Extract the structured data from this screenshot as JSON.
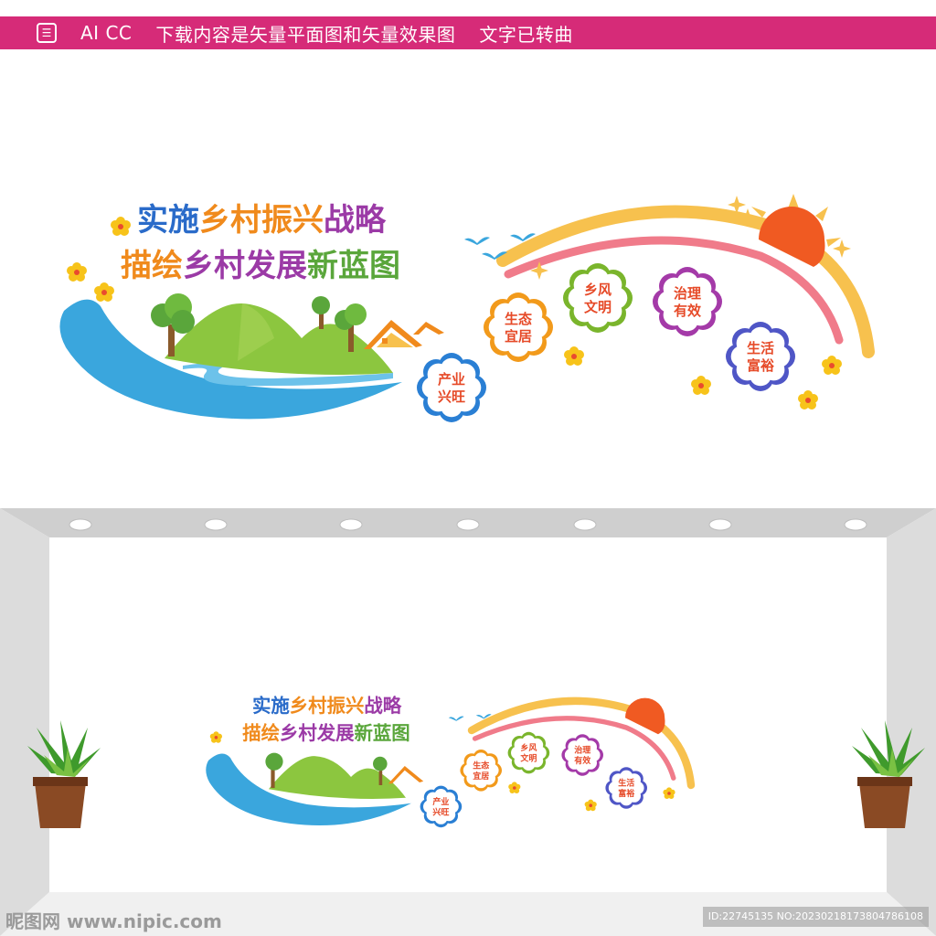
{
  "header": {
    "logo_glyph": "☰",
    "software": "AI CC",
    "description": "下载内容是矢量平面图和矢量效果图",
    "note": "文字已转曲",
    "bar_color": "#d62b78"
  },
  "design": {
    "title_line1_a": "实施",
    "title_line1_b": "乡村振兴",
    "title_line1_c": "战略",
    "title_line2_a": "描绘",
    "title_line2_b": "乡村发展",
    "title_line2_c": "新蓝图",
    "flowers": [
      {
        "line1": "产业",
        "line2": "兴旺",
        "color": "#2a7fd4"
      },
      {
        "line1": "生态",
        "line2": "宜居",
        "color": "#f29a1b"
      },
      {
        "line1": "乡风",
        "line2": "文明",
        "color": "#7ab52c"
      },
      {
        "line1": "治理",
        "line2": "有效",
        "color": "#a43aa8"
      },
      {
        "line1": "生活",
        "line2": "富裕",
        "color": "#4f56c6"
      }
    ],
    "colors": {
      "blue": "#2a6bc9",
      "orange": "#f08a1c",
      "purple": "#9b3aa6",
      "green": "#5aa63b",
      "river": "#3aa6dd",
      "hill": "#8cc63f",
      "sun": "#f05a22",
      "rainbow_outer": "#f7c14e",
      "rainbow_inner": "#f07b8a"
    }
  },
  "watermark": {
    "site": "昵图网 www.nipic.com",
    "id_text": "ID:22745135 NO:20230218173804786108"
  }
}
